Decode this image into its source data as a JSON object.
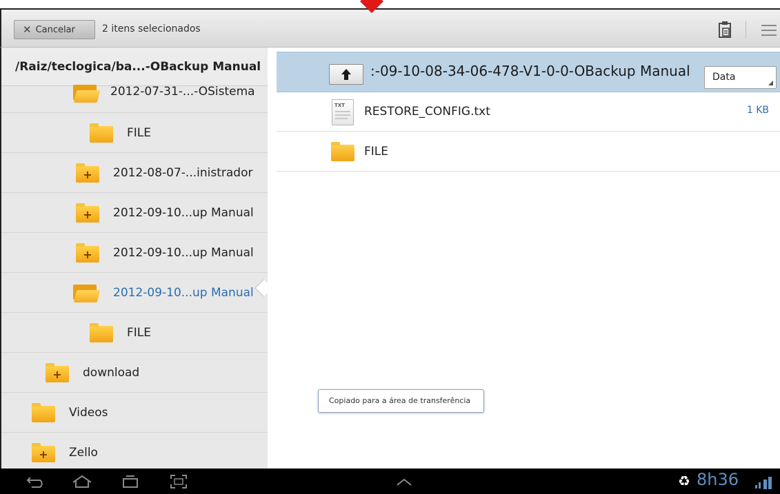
{
  "action_bar": {
    "cancel_label": "Cancelar",
    "cancel_icon": "close-icon",
    "selection_count_text": "2 itens selecionados",
    "clipboard_icon": "clipboard-icon",
    "menu_icon": "menu-icon"
  },
  "left_panel": {
    "path": "/Raiz/teclogica/ba...-OBackup Manual",
    "items": [
      {
        "label": "2012-07-31-...-OSistema",
        "icon": "folder-open-icon"
      },
      {
        "label": "FILE",
        "icon": "folder-icon"
      },
      {
        "label": "2012-08-07-...inistrador",
        "icon": "folder-plus-icon"
      },
      {
        "label": "2012-09-10...up Manual",
        "icon": "folder-plus-icon"
      },
      {
        "label": "2012-09-10...up Manual",
        "icon": "folder-plus-icon"
      },
      {
        "label": "2012-09-10...up Manual",
        "icon": "folder-open-icon",
        "active": true
      },
      {
        "label": "FILE",
        "icon": "folder-icon"
      },
      {
        "label": "download",
        "icon": "folder-plus-icon"
      },
      {
        "label": "Videos",
        "icon": "folder-icon"
      },
      {
        "label": "Zello",
        "icon": "folder-plus-icon"
      }
    ]
  },
  "right_panel": {
    "current_path": ":-09-10-08-34-06-478-V1-0-0-OBackup Manual",
    "up_icon": "arrow-up-icon",
    "sort_selected": "Data",
    "files": [
      {
        "name": "RESTORE_CONFIG.txt",
        "size": "1 KB",
        "icon": "txt-file-icon",
        "icon_tag": "TXT"
      },
      {
        "name": "FILE",
        "size": "",
        "icon": "folder-icon"
      }
    ],
    "toast": "Copiado para a área de transferência"
  },
  "system_bar": {
    "clock": "8h36",
    "icons": [
      "back-icon",
      "home-icon",
      "recent-apps-icon",
      "screenshot-icon",
      "chevron-up-icon",
      "recycle-icon",
      "signal-icon"
    ]
  },
  "colors": {
    "accent_blue": "#2a6db2",
    "header_selected": "#bcd3e6",
    "folder_yellow": "#f5ad20",
    "marker_red": "#e01818",
    "clock_blue": "#5f8fbf"
  }
}
